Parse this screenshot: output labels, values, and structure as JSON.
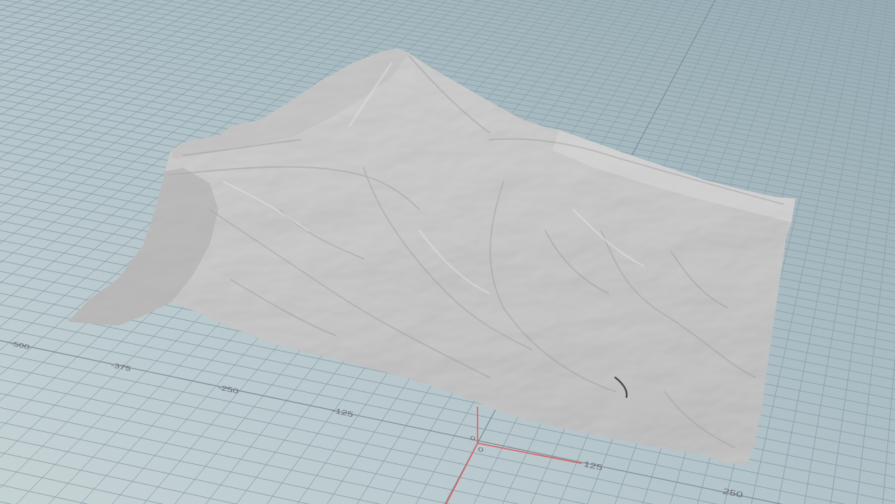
{
  "viewport": {
    "axis_labels": [
      {
        "text": "-500",
        "kind": "x_axis"
      },
      {
        "text": "-375",
        "kind": "x_axis"
      },
      {
        "text": "-250",
        "kind": "x_axis"
      },
      {
        "text": "-125",
        "kind": "x_axis"
      },
      {
        "text": "0",
        "kind": "x_axis"
      },
      {
        "text": "0",
        "kind": "z_axis"
      },
      {
        "text": "125",
        "kind": "x_axis"
      },
      {
        "text": "250",
        "kind": "x_axis"
      }
    ]
  }
}
